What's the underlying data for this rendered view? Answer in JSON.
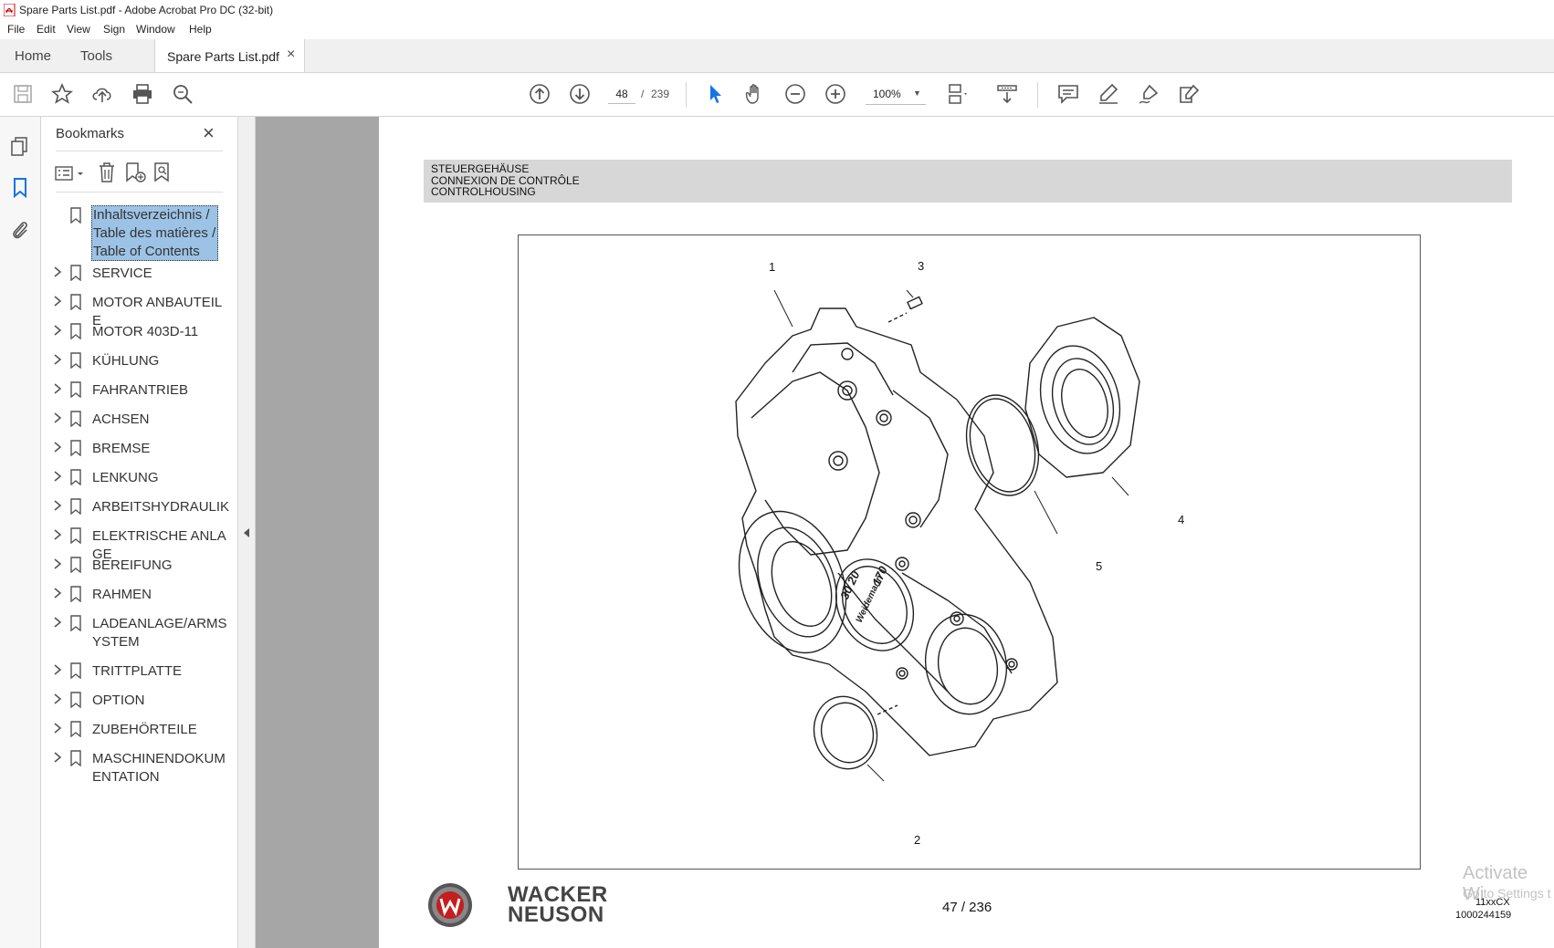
{
  "window": {
    "title": "Spare Parts List.pdf - Adobe Acrobat Pro DC (32-bit)"
  },
  "menu": [
    "File",
    "Edit",
    "View",
    "Sign",
    "Window",
    "Help"
  ],
  "tabs": {
    "home": "Home",
    "tools": "Tools",
    "document": "Spare Parts List.pdf"
  },
  "toolbar": {
    "current_page": "48",
    "page_sep": "/",
    "total_pages": "239",
    "zoom": "100%"
  },
  "bookmarks": {
    "title": "Bookmarks",
    "items": [
      {
        "label": "Inhaltsverzeichnis / Table des matières / Table of Contents",
        "selected": true,
        "expandable": false
      },
      {
        "label": "SERVICE",
        "expandable": true
      },
      {
        "label": "MOTOR ANBAUTEILE",
        "expandable": true
      },
      {
        "label": "MOTOR 403D-11",
        "expandable": true
      },
      {
        "label": "KÜHLUNG",
        "expandable": true
      },
      {
        "label": "FAHRANTRIEB",
        "expandable": true
      },
      {
        "label": "ACHSEN",
        "expandable": true
      },
      {
        "label": "BREMSE",
        "expandable": true
      },
      {
        "label": "LENKUNG",
        "expandable": true
      },
      {
        "label": "ARBEITSHYDRAULIK",
        "expandable": true
      },
      {
        "label": "ELEKTRISCHE ANLAGE",
        "expandable": true
      },
      {
        "label": "BEREIFUNG",
        "expandable": true
      },
      {
        "label": "RAHMEN",
        "expandable": true
      },
      {
        "label": "LADEANLAGE/ARMSYSTEM",
        "expandable": true
      },
      {
        "label": "TRITTPLATTE",
        "expandable": true
      },
      {
        "label": "OPTION",
        "expandable": true
      },
      {
        "label": "ZUBEHÖRTEILE",
        "expandable": true
      },
      {
        "label": "MASCHINENDOKUMENTATION",
        "expandable": true
      }
    ]
  },
  "document": {
    "header_lines": [
      "STEUERGEHÄUSE",
      "CONNEXION DE CONTRÔLE",
      "CONTROLHOUSING"
    ],
    "callouts": [
      "1",
      "2",
      "3",
      "4",
      "5"
    ],
    "page_number": "47 / 236",
    "brand_line1": "WACKER",
    "brand_line2": "NEUSON",
    "model_code": "11xxCX",
    "doc_number": "1000244159",
    "decal_text_1": "30 20",
    "decal_text_2": "Weidemann",
    "decal_text_3": "170"
  },
  "overlay": {
    "watermark_line1": "Activate Wi",
    "watermark_line2": "Go to Settings t"
  },
  "colors": {
    "accent": "#1473e6",
    "selection": "#9cc3e5",
    "gray_margin": "#a6a6a6",
    "header_band": "#d7d7d7"
  }
}
